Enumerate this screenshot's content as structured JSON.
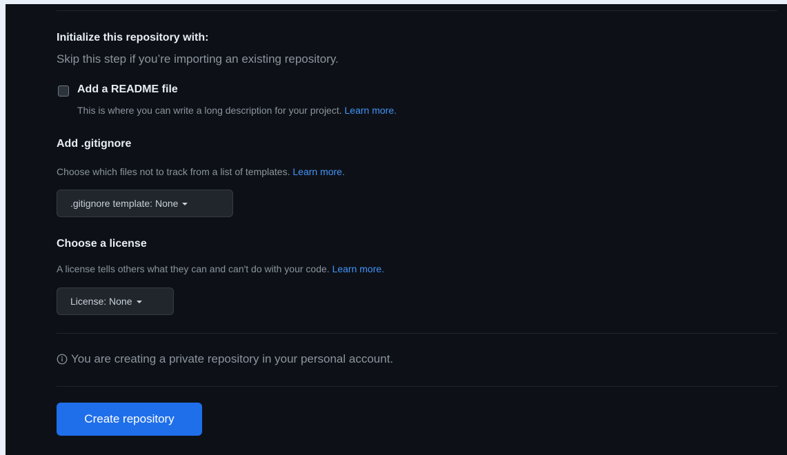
{
  "initialize": {
    "heading": "Initialize this repository with:",
    "subtext": "Skip this step if you’re importing an existing repository."
  },
  "readme": {
    "label": "Add a README file",
    "checked": false,
    "description": "This is where you can write a long description for your project.",
    "learn_more": "Learn more."
  },
  "gitignore": {
    "heading": "Add .gitignore",
    "description": "Choose which files not to track from a list of templates.",
    "learn_more": "Learn more.",
    "button_label": ".gitignore template: None"
  },
  "license": {
    "heading": "Choose a license",
    "description": "A license tells others what they can and can't do with your code.",
    "learn_more": "Learn more.",
    "button_label": "License: None"
  },
  "notice": {
    "icon": "info-icon",
    "text": "You are creating a private repository in your personal account."
  },
  "actions": {
    "create_label": "Create repository"
  },
  "colors": {
    "background": "#0d1117",
    "primary_button": "#1f6feb",
    "link": "#4493f8"
  }
}
